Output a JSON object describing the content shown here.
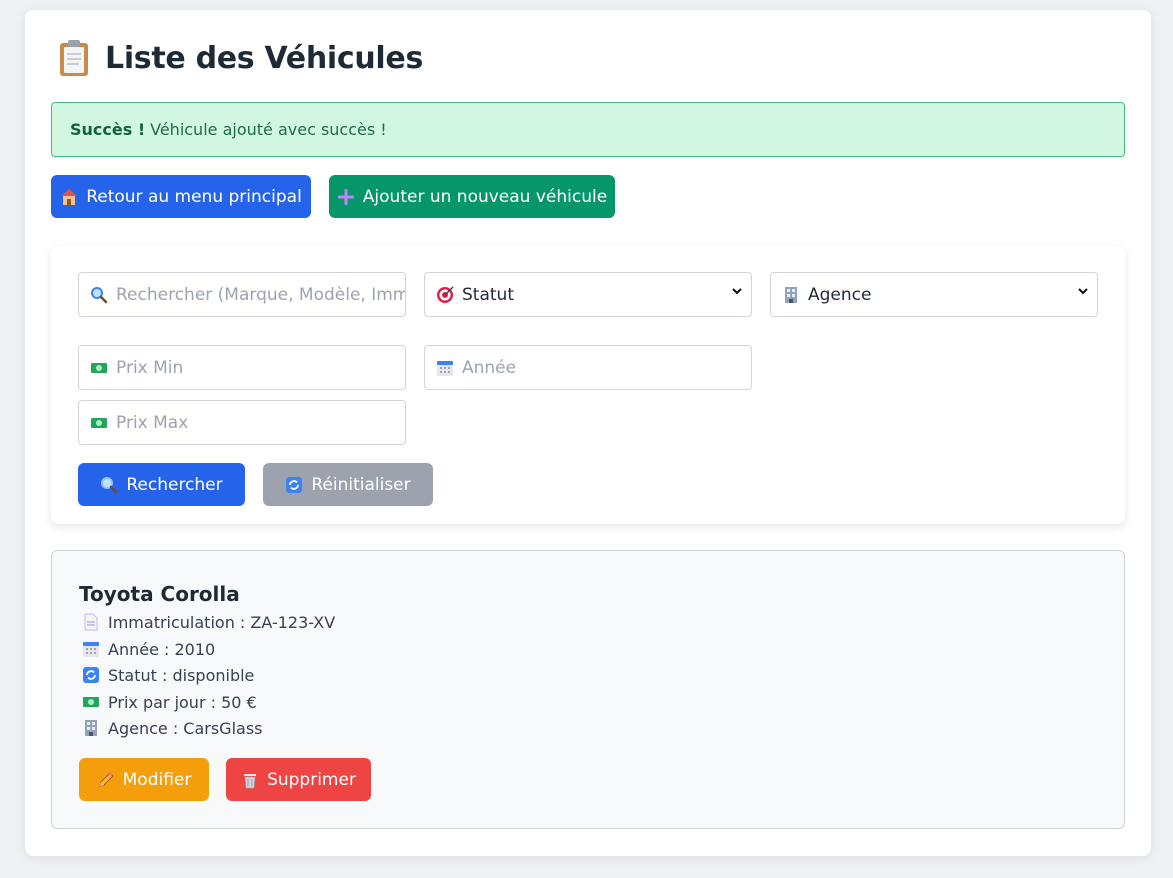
{
  "page": {
    "title": "Liste des Véhicules",
    "title_icon": "clipboard-icon"
  },
  "alert": {
    "strong": "Succès !",
    "message": "Véhicule ajouté avec succès !",
    "color": "#d1f7e3"
  },
  "actions": {
    "back_label": "Retour au menu principal",
    "back_icon": "house-icon",
    "add_label": "Ajouter un nouveau véhicule",
    "add_icon": "plus-icon"
  },
  "filters": {
    "search_placeholder": "Rechercher (Marque, Modèle, Immatriculation)",
    "status_selected": "Statut",
    "agency_selected": "Agence",
    "price_min_placeholder": "Prix Min",
    "year_placeholder": "Année",
    "price_max_placeholder": "Prix Max",
    "search_button": "Rechercher",
    "reset_button": "Réinitialiser"
  },
  "vehicle": {
    "name": "Toyota Corolla",
    "registration": "Immatriculation : ZA-123-XV",
    "year": "Année : 2010",
    "status": "Statut : disponible",
    "price": "Prix par jour : 50 €",
    "agency": "Agence : CarsGlass",
    "edit_button": "Modifier",
    "delete_button": "Supprimer"
  },
  "colors": {
    "primary": "#2563eb",
    "success": "#059669",
    "neutral": "#9ca3af",
    "warning": "#f59e0b",
    "danger": "#ef4444"
  }
}
